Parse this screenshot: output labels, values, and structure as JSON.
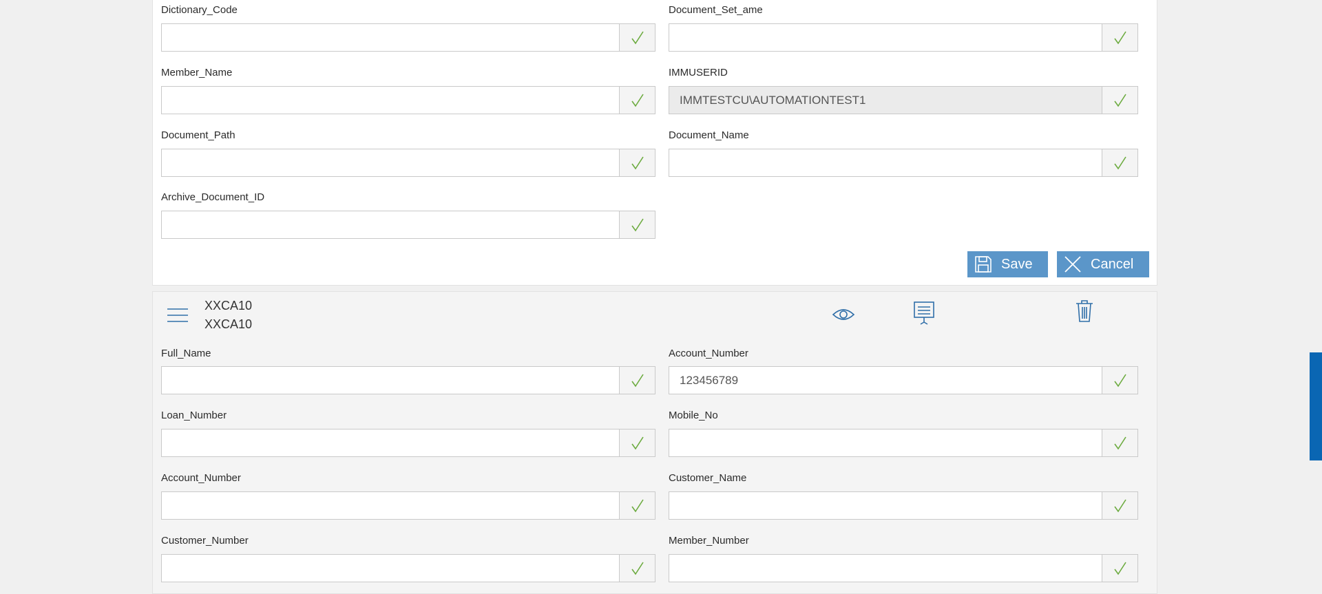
{
  "top_form": {
    "fields_left": [
      {
        "label": "Dictionary_Code",
        "value": ""
      },
      {
        "label": "Member_Name",
        "value": ""
      },
      {
        "label": "Document_Path",
        "value": ""
      },
      {
        "label": "Archive_Document_ID",
        "value": ""
      }
    ],
    "fields_right": [
      {
        "label": "Document_Set_ame",
        "value": ""
      },
      {
        "label": "IMMUSERID",
        "value": "IMMTESTCU\\AUTOMATIONTEST1",
        "readonly": true
      },
      {
        "label": "Document_Name",
        "value": ""
      }
    ],
    "save_label": "Save",
    "cancel_label": "Cancel"
  },
  "document_card": {
    "title_line1": "XXCA10",
    "title_line2": "XXCA10",
    "icons": [
      "menu-icon",
      "eye-icon",
      "monitor-icon",
      "trash-icon"
    ],
    "fields_left": [
      {
        "label": "Full_Name",
        "value": ""
      },
      {
        "label": "Loan_Number",
        "value": ""
      },
      {
        "label": "Account_Number",
        "value": ""
      },
      {
        "label": "Customer_Number",
        "value": ""
      }
    ],
    "fields_right": [
      {
        "label": "Account_Number",
        "value": "123456789"
      },
      {
        "label": "Mobile_No",
        "value": ""
      },
      {
        "label": "Customer_Name",
        "value": ""
      },
      {
        "label": "Member_Number",
        "value": ""
      }
    ]
  },
  "colors": {
    "accent": "#5b96c9",
    "check": "#6cab3f",
    "side_tab": "#0a66b3",
    "icon_blue": "#2f6ea8"
  }
}
